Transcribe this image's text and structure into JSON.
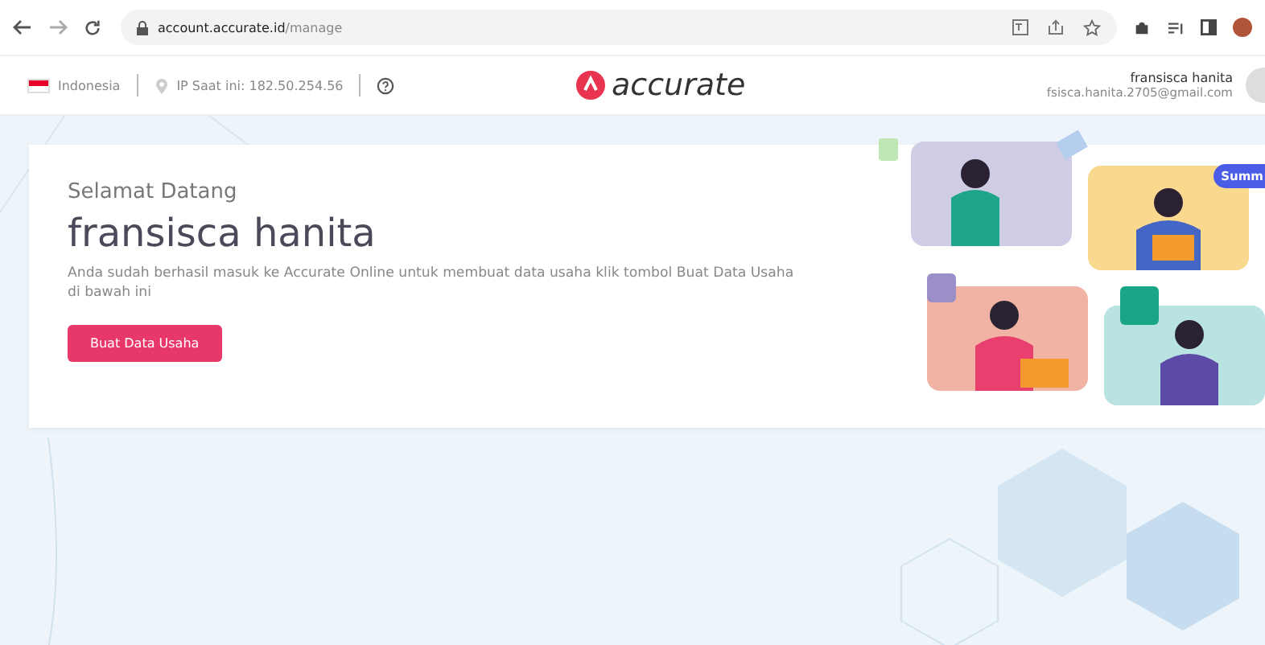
{
  "browser": {
    "url_host": "account.accurate.id",
    "url_path": "/manage"
  },
  "header": {
    "country": "Indonesia",
    "ip": "IP Saat ini: 182.50.254.56",
    "logo": "accurate",
    "user_name": "fransisca hanita",
    "user_email": "fsisca.hanita.2705@gmail.com"
  },
  "welcome": {
    "greeting": "Selamat Datang",
    "name": "fransisca hanita",
    "message": "Anda sudah berhasil masuk ke Accurate Online untuk membuat data usaha klik tombol Buat Data Usaha di bawah ini",
    "button": "Buat Data Usaha",
    "badge": "Summ"
  }
}
